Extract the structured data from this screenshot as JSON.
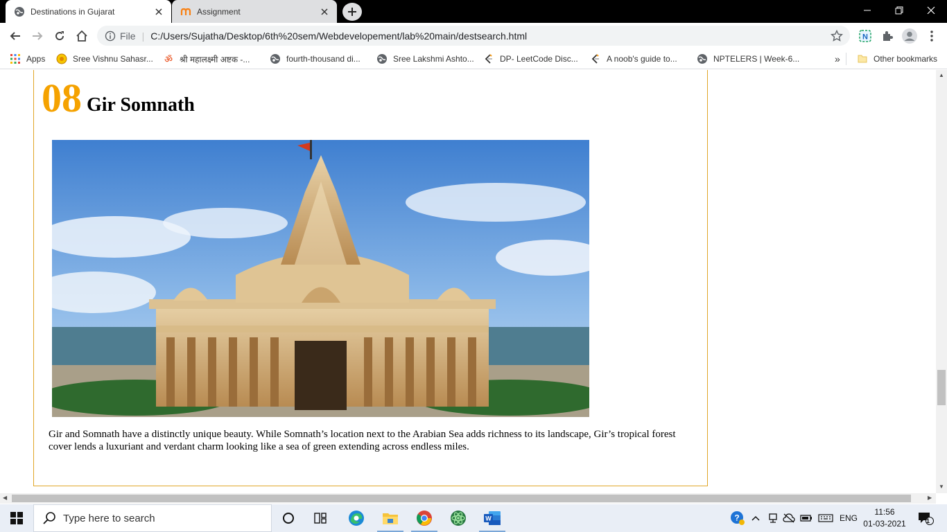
{
  "browser": {
    "tabs": [
      {
        "title": "Destinations in Gujarat",
        "active": true
      },
      {
        "title": "Assignment",
        "active": false
      }
    ],
    "address": {
      "scheme": "File",
      "url": "C:/Users/Sujatha/Desktop/6th%20sem/Webdevelopement/lab%20main/destsearch.html"
    },
    "bookmarks": [
      {
        "label": "Apps",
        "icon": "apps-grid-icon"
      },
      {
        "label": "Sree Vishnu Sahasr...",
        "icon": "sun-icon"
      },
      {
        "label": "श्री महालक्ष्मी अष्टक -...",
        "icon": "om-icon"
      },
      {
        "label": "fourth-thousand di...",
        "icon": "globe-icon"
      },
      {
        "label": "Sree Lakshmi Ashto...",
        "icon": "globe-icon"
      },
      {
        "label": "DP- LeetCode Disc...",
        "icon": "leetcode-icon"
      },
      {
        "label": "A noob's guide to...",
        "icon": "leetcode-icon"
      },
      {
        "label": "NPTELERS | Week-6...",
        "icon": "globe-icon"
      }
    ],
    "other_bookmarks": "Other bookmarks",
    "more_bookmarks": "»"
  },
  "page": {
    "number": "08",
    "title": "Gir Somnath",
    "description": "Gir and Somnath have a distinctly unique beauty. While Somnath’s location next to the Arabian Sea adds richness to its landscape, Gir’s tropical forest cover lends a luxuriant and verdant charm looking like a sea of green extending across endless miles.",
    "accent_color": "#f5a200",
    "border_color": "#e0a526"
  },
  "taskbar": {
    "search_placeholder": "Type here to search",
    "language": "ENG",
    "time": "11:56",
    "date": "01-03-2021",
    "notification_count": "1"
  }
}
